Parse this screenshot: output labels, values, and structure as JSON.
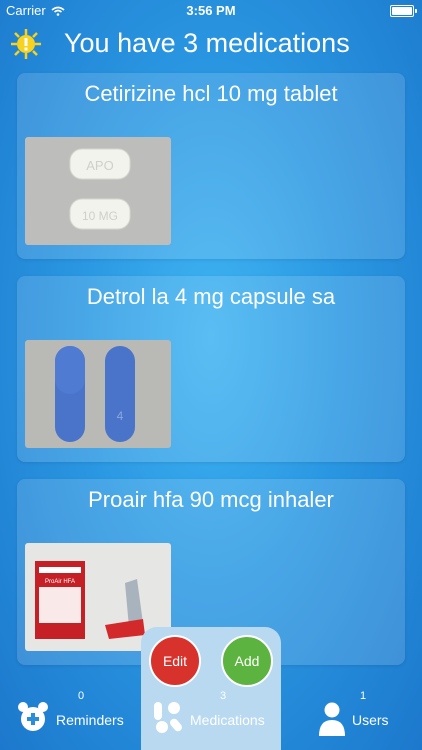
{
  "status_bar": {
    "carrier": "Carrier",
    "time": "3:56 PM"
  },
  "header": {
    "title": "You have 3 medications"
  },
  "medications": [
    {
      "name": "Cetirizine hcl 10 mg tablet",
      "imprint_top": "APO",
      "imprint_bottom": "10 MG"
    },
    {
      "name": "Detrol la 4 mg capsule sa",
      "imprint": "4"
    },
    {
      "name": "Proair hfa 90 mcg inhaler",
      "box_label": "ProAir HFA"
    }
  ],
  "actions": {
    "edit_label": "Edit",
    "add_label": "Add"
  },
  "tabs": [
    {
      "label": "Reminders",
      "count": "0"
    },
    {
      "label": "Medications",
      "count": "3"
    },
    {
      "label": "Users",
      "count": "1"
    }
  ],
  "colors": {
    "edit": "#d7332c",
    "add": "#5db33f",
    "background": "#2a97e2"
  }
}
